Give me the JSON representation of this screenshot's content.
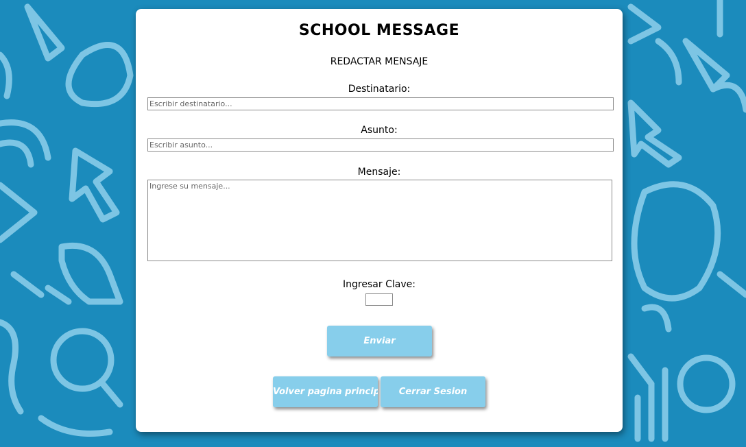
{
  "header": {
    "title": "SCHOOL MESSAGE",
    "subtitle": "REDACTAR MENSAJE"
  },
  "form": {
    "recipient_label": "Destinatario:",
    "recipient_placeholder": "Escribir destinatario...",
    "subject_label": "Asunto:",
    "subject_placeholder": "Escribir asunto...",
    "message_label": "Mensaje:",
    "message_placeholder": "Ingrese su mensaje...",
    "key_label": "Ingresar Clave:"
  },
  "buttons": {
    "send": "Enviar",
    "back_home": "Volver pagina principal",
    "logout": "Cerrar Sesion"
  },
  "colors": {
    "background": "#1b8bbc",
    "button": "#87ceeb",
    "card": "#ffffff"
  }
}
